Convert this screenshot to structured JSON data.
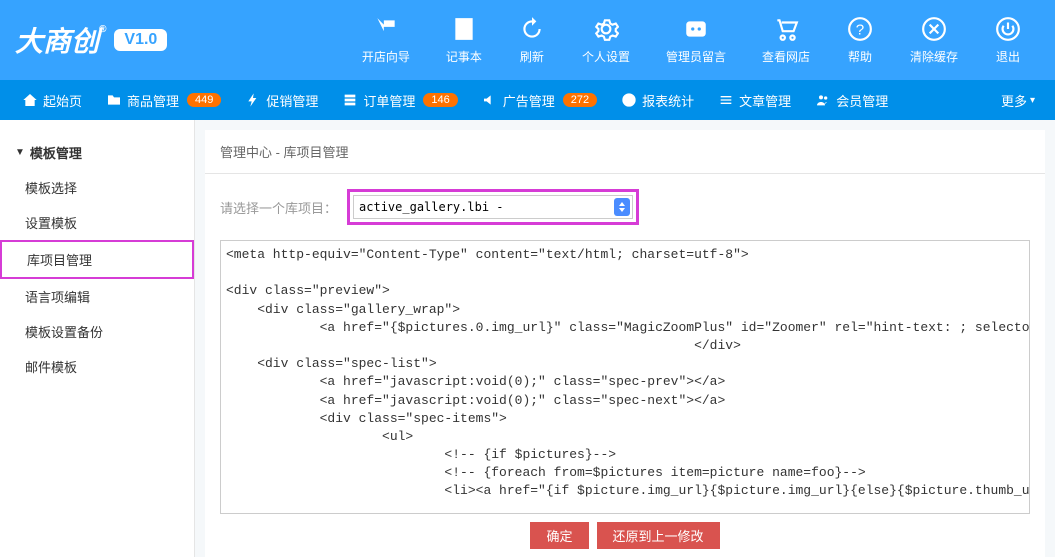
{
  "logo": {
    "text": "大商创",
    "version": "V1.0"
  },
  "topActions": [
    {
      "label": "开店向导"
    },
    {
      "label": "记事本"
    },
    {
      "label": "刷新"
    },
    {
      "label": "个人设置"
    },
    {
      "label": "管理员留言"
    },
    {
      "label": "查看网店"
    },
    {
      "label": "帮助"
    },
    {
      "label": "清除缓存"
    },
    {
      "label": "退出"
    }
  ],
  "nav": [
    {
      "label": "起始页",
      "badge": null
    },
    {
      "label": "商品管理",
      "badge": "449"
    },
    {
      "label": "促销管理",
      "badge": null
    },
    {
      "label": "订单管理",
      "badge": "146"
    },
    {
      "label": "广告管理",
      "badge": "272"
    },
    {
      "label": "报表统计",
      "badge": null
    },
    {
      "label": "文章管理",
      "badge": null
    },
    {
      "label": "会员管理",
      "badge": null
    }
  ],
  "navMore": "更多",
  "sidebar": {
    "header": "模板管理",
    "items": [
      {
        "label": "模板选择"
      },
      {
        "label": "设置模板"
      },
      {
        "label": "库项目管理"
      },
      {
        "label": "语言项编辑"
      },
      {
        "label": "模板设置备份"
      },
      {
        "label": "邮件模板"
      }
    ]
  },
  "breadcrumb": "管理中心  -  库项目管理",
  "form": {
    "label": "请选择一个库项目：",
    "selectValue": "active_gallery.lbi -"
  },
  "codeContent": "<meta http-equiv=\"Content-Type\" content=\"text/html; charset=utf-8\">\n\n<div class=\"preview\">\n    <div class=\"gallery_wrap\">\n            <a href=\"{$pictures.0.img_url}\" class=\"MagicZoomPlus\" id=\"Zoomer\" rel=\"hint-text: ; selectors-effect: false; selectors-class: img-hover; zoom-distance: 10;zoom-width: 400; zoom-height: 474;\"><img src=\"themes/<?php echo $GLOBALS['_CFG']['template']; ?>/images/loadGoods3.gif\" alt=\"{$goods.goods_name|escape:html}\" width=\"372\" height=\"372\" class=\"lazy\" data-original=\"{$goods.goods_img}\"/></a>\n                                                            </div>\n    <div class=\"spec-list\">\n            <a href=\"javascript:void(0);\" class=\"spec-prev\"></a>\n            <a href=\"javascript:void(0);\" class=\"spec-next\"></a>\n            <div class=\"spec-items\">\n                    <ul>\n                            <!-- {if $pictures}-->\n                            <!-- {foreach from=$pictures item=picture name=foo}-->\n                            <li><a href=\"{if $picture.img_url}{$picture.img_url}{else}{$picture.thumb_url}{/if}\" rel=\"zoom-id: Zoomer\" rev=\"{if $picture.img_url}{$picture.img_url}{else}{$picture.thumb_url}{/if}\"><img src=\"themes/<?php echo $GLOBALS['_CFG']['template']; ?>/images/loadGoods.gif\" alt=\"{$goods.goods_name}\"",
  "buttons": {
    "confirm": "确定",
    "revert": "还原到上一修改"
  }
}
